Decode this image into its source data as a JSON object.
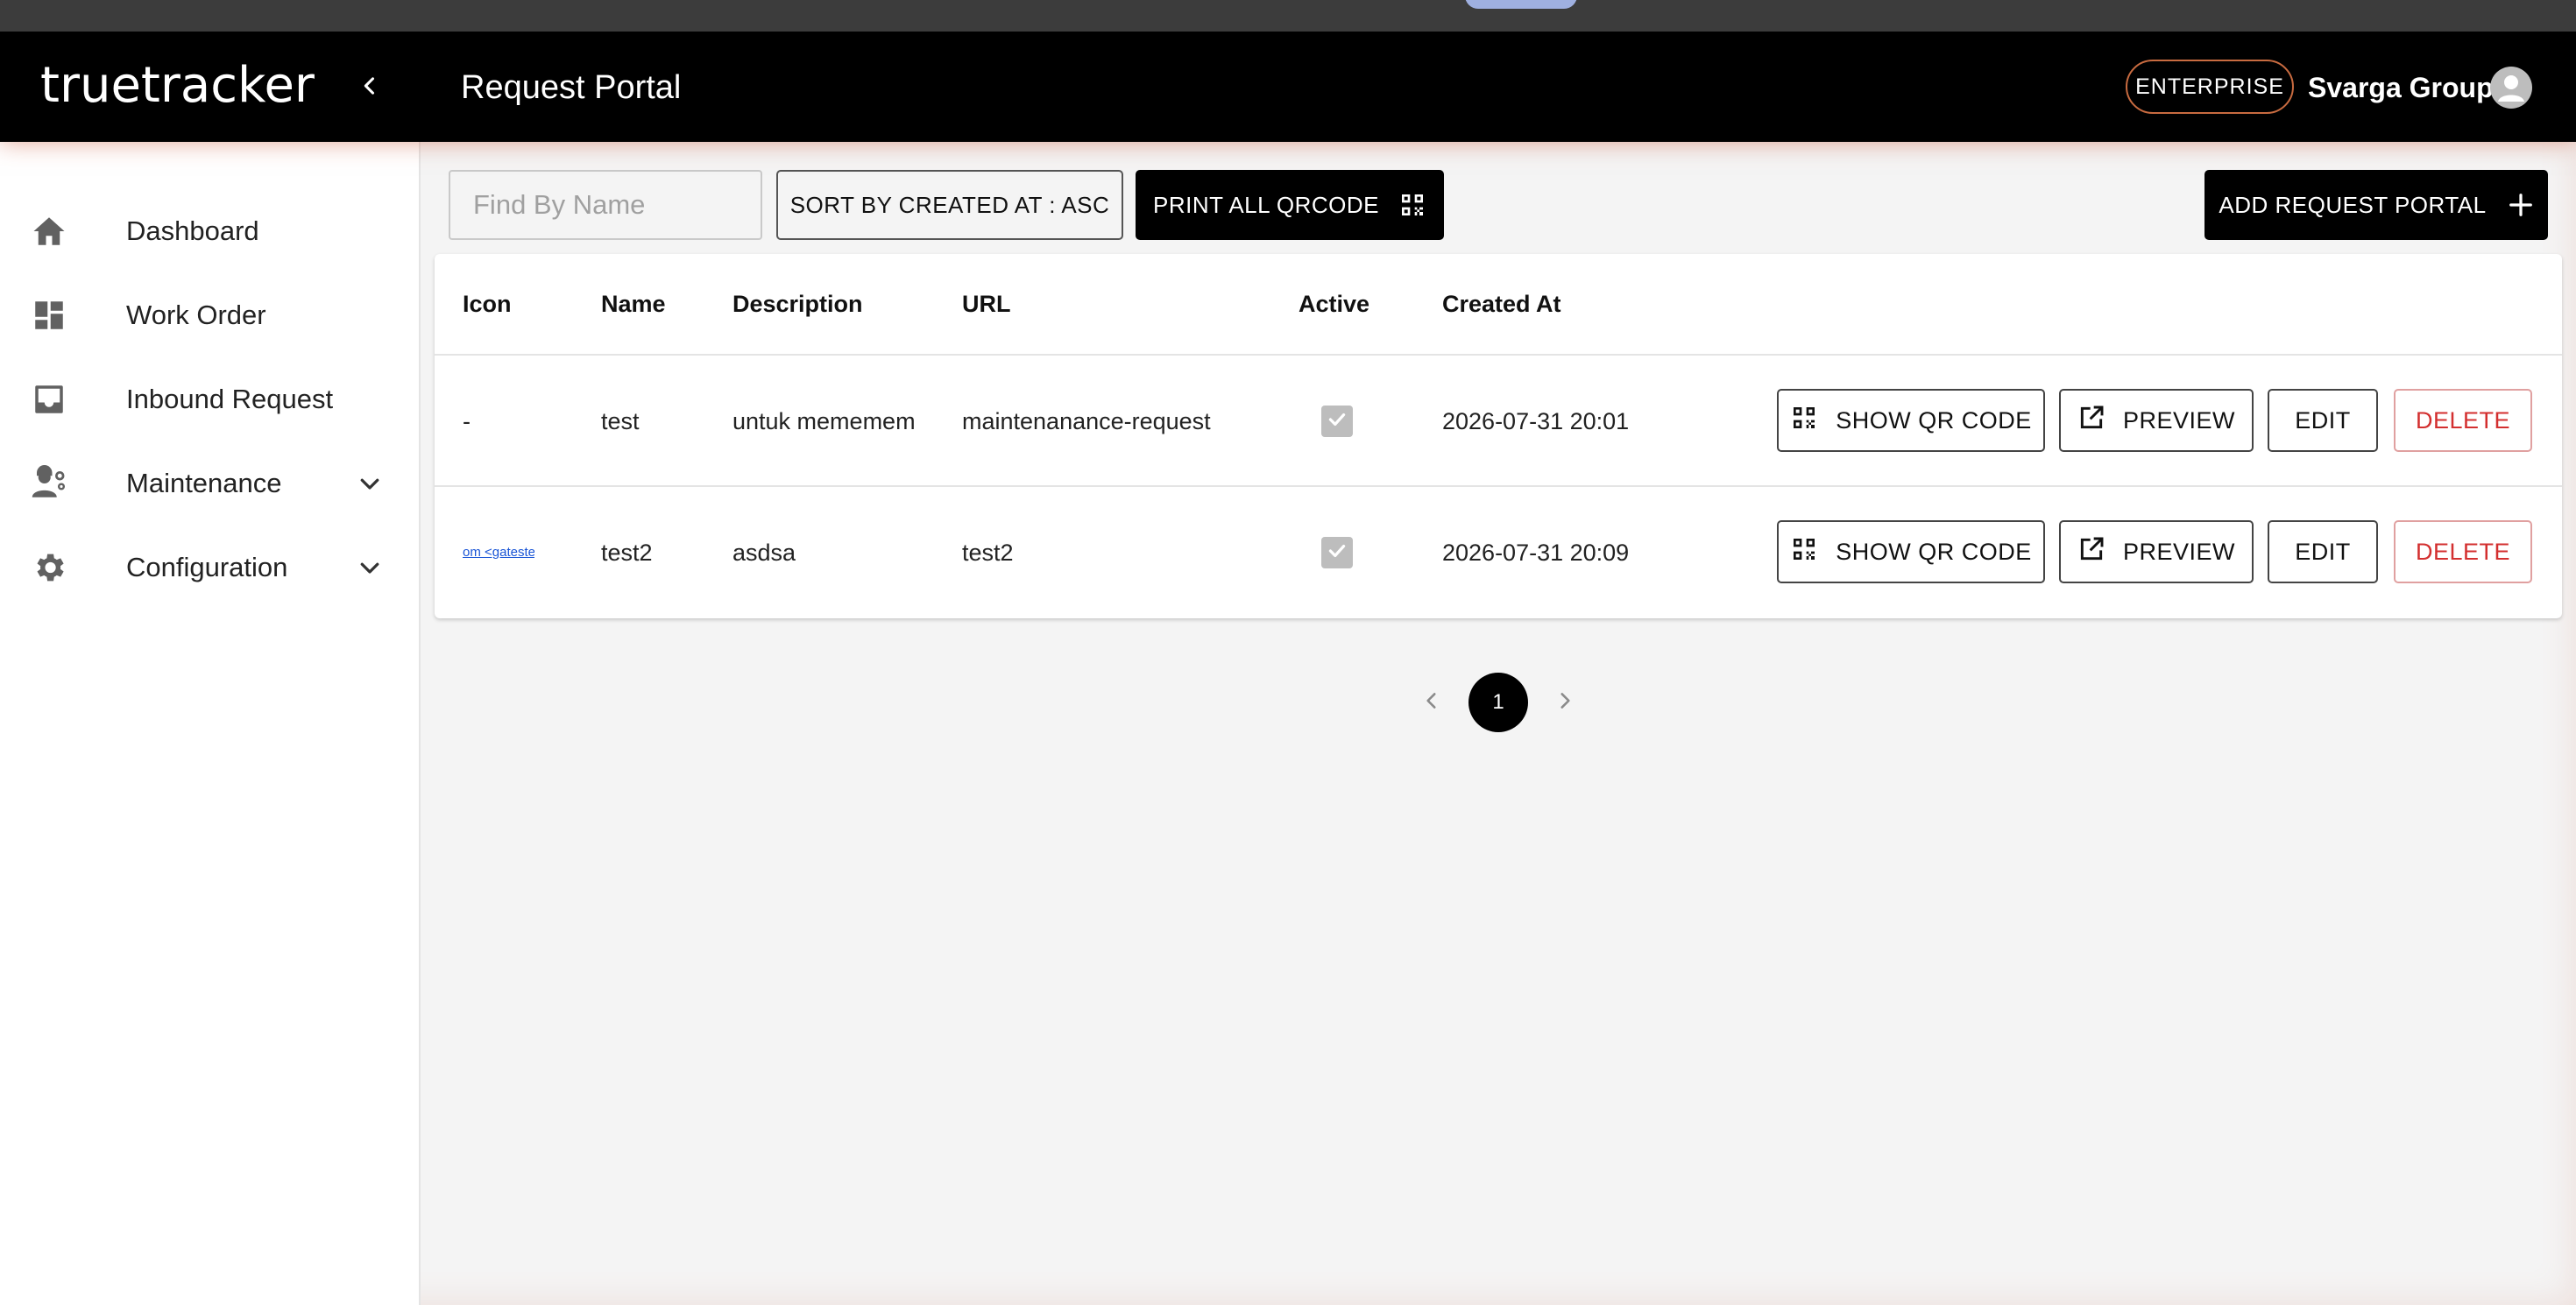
{
  "header": {
    "logo_text": "truetracker",
    "page_title": "Request Portal",
    "plan_badge": "ENTERPRISE",
    "org_name": "Svarga Group"
  },
  "sidebar": {
    "items": [
      {
        "label": "Dashboard",
        "icon": "home-icon"
      },
      {
        "label": "Work Order",
        "icon": "dashboard-grid-icon"
      },
      {
        "label": "Inbound Request",
        "icon": "inbox-icon"
      },
      {
        "label": "Maintenance",
        "icon": "engineer-icon",
        "expandable": true
      },
      {
        "label": "Configuration",
        "icon": "gear-icon",
        "expandable": true
      }
    ]
  },
  "toolbar": {
    "search_placeholder": "Find By Name",
    "sort_label": "SORT BY CREATED AT : ASC",
    "print_label": "PRINT ALL QRCODE",
    "add_label": "ADD REQUEST PORTAL"
  },
  "table": {
    "headers": [
      "Icon",
      "Name",
      "Description",
      "URL",
      "Active",
      "Created At"
    ],
    "rows": [
      {
        "icon": "-",
        "name": "test",
        "description": "untuk mememem",
        "url": "maintenanance-request",
        "active": true,
        "created_at": "2026-07-31 20:01"
      },
      {
        "icon": "om <gatester",
        "name": "test2",
        "description": "asdsa",
        "url": "test2",
        "active": true,
        "created_at": "2026-07-31 20:09"
      }
    ],
    "actions": {
      "show_qr": "SHOW QR CODE",
      "preview": "PREVIEW",
      "edit": "EDIT",
      "delete": "DELETE"
    }
  },
  "pagination": {
    "current_page": "1"
  },
  "colors": {
    "header_bg": "#000000",
    "accent_border": "#c86b40",
    "danger": "#d32f2f",
    "link": "#1a55d6"
  }
}
